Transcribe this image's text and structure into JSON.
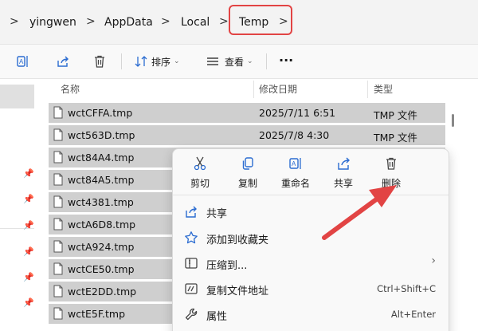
{
  "breadcrumb": {
    "items": [
      "yingwen",
      "AppData",
      "Local",
      "Temp"
    ],
    "separator": ">"
  },
  "toolbar": {
    "sort_label": "排序",
    "view_label": "查看",
    "more_label": "···"
  },
  "columns": {
    "name": "名称",
    "date": "修改日期",
    "type": "类型"
  },
  "files": [
    {
      "name": "wctCFFA.tmp",
      "date": "2025/7/11 6:51",
      "type": "TMP 文件"
    },
    {
      "name": "wct563D.tmp",
      "date": "2025/7/8 4:30",
      "type": "TMP 文件"
    },
    {
      "name": "wct84A4.tmp",
      "date": "",
      "type": ""
    },
    {
      "name": "wct84A5.tmp",
      "date": "",
      "type": ""
    },
    {
      "name": "wct4381.tmp",
      "date": "",
      "type": ""
    },
    {
      "name": "wctA6D8.tmp",
      "date": "",
      "type": ""
    },
    {
      "name": "wctA924.tmp",
      "date": "",
      "type": ""
    },
    {
      "name": "wctCE50.tmp",
      "date": "",
      "type": ""
    },
    {
      "name": "wctE2DD.tmp",
      "date": "",
      "type": ""
    },
    {
      "name": "wctE5F.tmp",
      "date": "",
      "type": ""
    }
  ],
  "context_menu": {
    "quick_actions": [
      {
        "label": "剪切",
        "icon": "scissors-icon"
      },
      {
        "label": "复制",
        "icon": "copy-icon"
      },
      {
        "label": "重命名",
        "icon": "rename-icon"
      },
      {
        "label": "共享",
        "icon": "share-icon"
      },
      {
        "label": "删除",
        "icon": "trash-icon"
      }
    ],
    "items": [
      {
        "label": "共享",
        "icon": "share-icon",
        "shortcut": ""
      },
      {
        "label": "添加到收藏夹",
        "icon": "star-icon",
        "shortcut": ""
      },
      {
        "label": "压缩到...",
        "icon": "zip-icon",
        "shortcut": ""
      },
      {
        "label": "复制文件地址",
        "icon": "path-icon",
        "shortcut": "Ctrl+Shift+C"
      },
      {
        "label": "属性",
        "icon": "wrench-icon",
        "shortcut": "Alt+Enter"
      }
    ]
  },
  "colors": {
    "highlight_red": "#e24444",
    "selection_gray": "#cfcfcf",
    "accent_blue": "#2b6cd1"
  }
}
